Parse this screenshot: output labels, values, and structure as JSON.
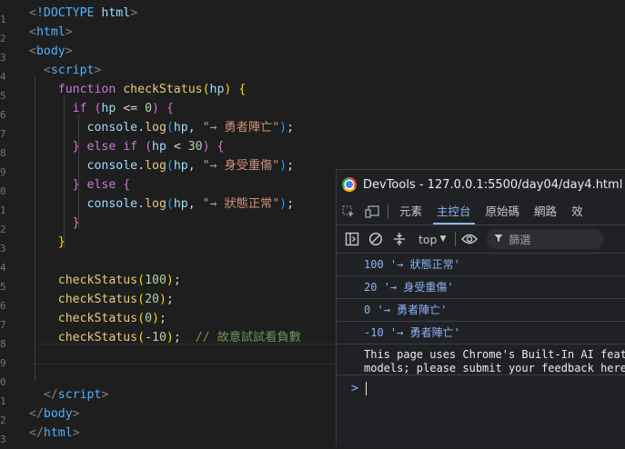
{
  "editor": {
    "line_numbers": [
      "",
      "1",
      "2",
      "3",
      "4",
      "5",
      "6",
      "7",
      "8",
      "9",
      "0",
      "1",
      "2",
      "3",
      "4",
      "5",
      "6",
      "7",
      "8",
      "9",
      "0",
      "1",
      "2",
      "3"
    ],
    "lines": [
      [
        {
          "c": "t-br",
          "t": "<"
        },
        {
          "c": "t-doctype",
          "t": "!DOCTYPE"
        },
        {
          "c": "t-var",
          "t": " html"
        },
        {
          "c": "t-br",
          "t": ">"
        }
      ],
      [
        {
          "c": "t-br",
          "t": "<"
        },
        {
          "c": "t-tag",
          "t": "html"
        },
        {
          "c": "t-br",
          "t": ">"
        }
      ],
      [
        {
          "c": "t-br",
          "t": "<"
        },
        {
          "c": "t-tag",
          "t": "body"
        },
        {
          "c": "t-br",
          "t": ">"
        }
      ],
      [
        {
          "c": "t-br",
          "t": "  <"
        },
        {
          "c": "t-tag",
          "t": "script"
        },
        {
          "c": "t-br",
          "t": ">"
        }
      ],
      [
        {
          "c": "t-pn",
          "t": "    "
        },
        {
          "c": "t-kw",
          "t": "function "
        },
        {
          "c": "t-fn",
          "t": "checkStatus"
        },
        {
          "c": "t-b1",
          "t": "("
        },
        {
          "c": "t-var",
          "t": "hp"
        },
        {
          "c": "t-b1",
          "t": ")"
        },
        {
          "c": "t-pn",
          "t": " "
        },
        {
          "c": "t-b1",
          "t": "{"
        }
      ],
      [
        {
          "c": "t-pn",
          "t": "      "
        },
        {
          "c": "t-kw",
          "t": "if "
        },
        {
          "c": "t-b2",
          "t": "("
        },
        {
          "c": "t-var",
          "t": "hp"
        },
        {
          "c": "t-pn",
          "t": " <= "
        },
        {
          "c": "t-num",
          "t": "0"
        },
        {
          "c": "t-b2",
          "t": ")"
        },
        {
          "c": "t-pn",
          "t": " "
        },
        {
          "c": "t-b2",
          "t": "{"
        }
      ],
      [
        {
          "c": "t-pn",
          "t": "        "
        },
        {
          "c": "t-var",
          "t": "console"
        },
        {
          "c": "t-pn",
          "t": "."
        },
        {
          "c": "t-fn",
          "t": "log"
        },
        {
          "c": "t-b3",
          "t": "("
        },
        {
          "c": "t-var",
          "t": "hp"
        },
        {
          "c": "t-pn",
          "t": ", "
        },
        {
          "c": "t-str",
          "t": "\"→ 勇者陣亡\""
        },
        {
          "c": "t-b3",
          "t": ")"
        },
        {
          "c": "t-pn",
          "t": ";"
        }
      ],
      [
        {
          "c": "t-pn",
          "t": "      "
        },
        {
          "c": "t-b2",
          "t": "}"
        },
        {
          "c": "t-kw",
          "t": " else if "
        },
        {
          "c": "t-b2",
          "t": "("
        },
        {
          "c": "t-var",
          "t": "hp"
        },
        {
          "c": "t-pn",
          "t": " < "
        },
        {
          "c": "t-num",
          "t": "30"
        },
        {
          "c": "t-b2",
          "t": ")"
        },
        {
          "c": "t-pn",
          "t": " "
        },
        {
          "c": "t-b2",
          "t": "{"
        }
      ],
      [
        {
          "c": "t-pn",
          "t": "        "
        },
        {
          "c": "t-var",
          "t": "console"
        },
        {
          "c": "t-pn",
          "t": "."
        },
        {
          "c": "t-fn",
          "t": "log"
        },
        {
          "c": "t-b3",
          "t": "("
        },
        {
          "c": "t-var",
          "t": "hp"
        },
        {
          "c": "t-pn",
          "t": ", "
        },
        {
          "c": "t-str",
          "t": "\"→ 身受重傷\""
        },
        {
          "c": "t-b3",
          "t": ")"
        },
        {
          "c": "t-pn",
          "t": ";"
        }
      ],
      [
        {
          "c": "t-pn",
          "t": "      "
        },
        {
          "c": "t-b2",
          "t": "}"
        },
        {
          "c": "t-kw",
          "t": " else "
        },
        {
          "c": "t-b2",
          "t": "{"
        }
      ],
      [
        {
          "c": "t-pn",
          "t": "        "
        },
        {
          "c": "t-var",
          "t": "console"
        },
        {
          "c": "t-pn",
          "t": "."
        },
        {
          "c": "t-fn",
          "t": "log"
        },
        {
          "c": "t-b3",
          "t": "("
        },
        {
          "c": "t-var",
          "t": "hp"
        },
        {
          "c": "t-pn",
          "t": ", "
        },
        {
          "c": "t-str",
          "t": "\"→ 狀態正常\""
        },
        {
          "c": "t-b3",
          "t": ")"
        },
        {
          "c": "t-pn",
          "t": ";"
        }
      ],
      [
        {
          "c": "t-pn",
          "t": "      "
        },
        {
          "c": "t-b2",
          "t": "}"
        }
      ],
      [
        {
          "c": "t-pn",
          "t": "    "
        },
        {
          "c": "t-b1",
          "t": "}"
        }
      ],
      [],
      [
        {
          "c": "t-pn",
          "t": "    "
        },
        {
          "c": "t-fn",
          "t": "checkStatus"
        },
        {
          "c": "t-b1",
          "t": "("
        },
        {
          "c": "t-num",
          "t": "100"
        },
        {
          "c": "t-b1",
          "t": ")"
        },
        {
          "c": "t-pn",
          "t": ";"
        }
      ],
      [
        {
          "c": "t-pn",
          "t": "    "
        },
        {
          "c": "t-fn",
          "t": "checkStatus"
        },
        {
          "c": "t-b1",
          "t": "("
        },
        {
          "c": "t-num",
          "t": "20"
        },
        {
          "c": "t-b1",
          "t": ")"
        },
        {
          "c": "t-pn",
          "t": ";"
        }
      ],
      [
        {
          "c": "t-pn",
          "t": "    "
        },
        {
          "c": "t-fn",
          "t": "checkStatus"
        },
        {
          "c": "t-b1",
          "t": "("
        },
        {
          "c": "t-num",
          "t": "0"
        },
        {
          "c": "t-b1",
          "t": ")"
        },
        {
          "c": "t-pn",
          "t": ";"
        }
      ],
      [
        {
          "c": "t-pn",
          "t": "    "
        },
        {
          "c": "t-fn",
          "t": "checkStatus"
        },
        {
          "c": "t-b1",
          "t": "("
        },
        {
          "c": "t-pn",
          "t": "-"
        },
        {
          "c": "t-num",
          "t": "10"
        },
        {
          "c": "t-b1",
          "t": ")"
        },
        {
          "c": "t-pn",
          "t": ";  "
        },
        {
          "c": "t-cm",
          "t": "// 故意試試看負數"
        }
      ],
      [],
      [],
      [
        {
          "c": "t-br",
          "t": "  </"
        },
        {
          "c": "t-tag",
          "t": "script"
        },
        {
          "c": "t-br",
          "t": ">"
        }
      ],
      [
        {
          "c": "t-br",
          "t": "</"
        },
        {
          "c": "t-tag",
          "t": "body"
        },
        {
          "c": "t-br",
          "t": ">"
        }
      ],
      [
        {
          "c": "t-br",
          "t": "</"
        },
        {
          "c": "t-tag",
          "t": "html"
        },
        {
          "c": "t-br",
          "t": ">"
        }
      ]
    ]
  },
  "devtools": {
    "title": "DevTools - 127.0.0.1:5500/day04/day4.html",
    "icons": {
      "inspect": "inspect-element-icon",
      "device": "device-toggle-icon"
    },
    "tabs": [
      {
        "label": "元素",
        "active": false
      },
      {
        "label": "主控台",
        "active": true
      },
      {
        "label": "原始碼",
        "active": false
      },
      {
        "label": "網路",
        "active": false
      },
      {
        "label": "效",
        "active": false
      }
    ],
    "toolbar": {
      "context": "top",
      "context_arrow": "▼",
      "filter_placeholder": "篩選"
    },
    "console_rows": [
      {
        "num": "100",
        "text": "'→ 狀態正常'"
      },
      {
        "num": "20",
        "text": "'→ 身受重傷'"
      },
      {
        "num": "0",
        "text": "'→ 勇者陣亡'"
      },
      {
        "num": "-10",
        "text": "'→ 勇者陣亡'"
      }
    ],
    "info_message": {
      "line1": "This page uses Chrome's Built-In AI feat",
      "line2": "models; please submit your feedback here"
    },
    "prompt_symbol": ">"
  }
}
